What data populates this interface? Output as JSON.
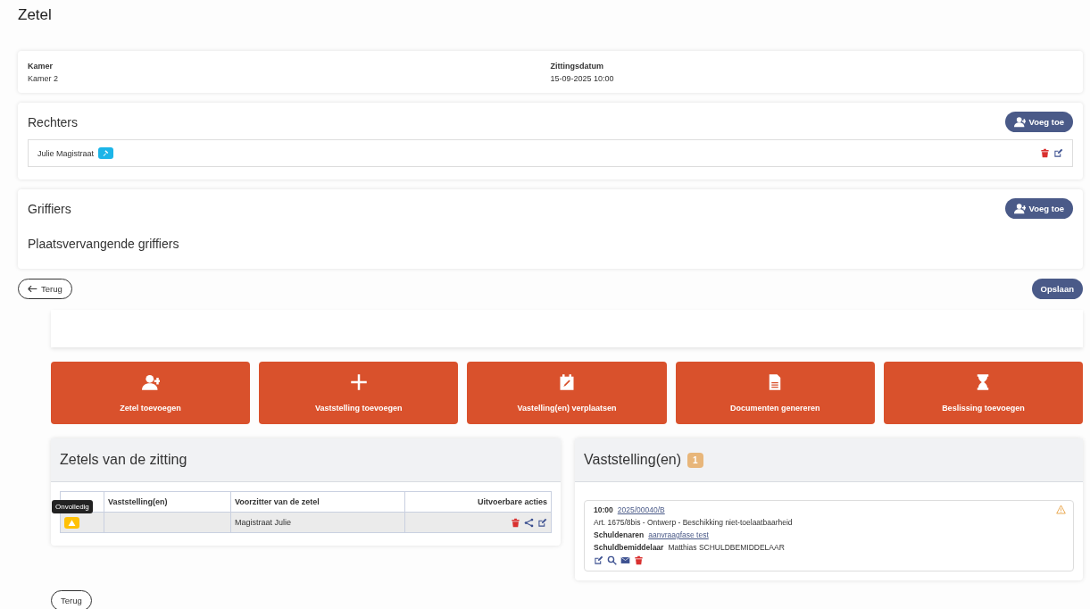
{
  "page": {
    "title": "Zetel"
  },
  "info": [
    {
      "label": "Kamer",
      "value": "Kamer 2"
    },
    {
      "label": "Zittingsdatum",
      "value": "15-09-2025 10:00"
    }
  ],
  "rechters": {
    "title": "Rechters",
    "add_button": "Voeg toe",
    "members": [
      {
        "name": "Julie Magistraat"
      }
    ]
  },
  "griffiers": {
    "title": "Griffiers",
    "add_button": "Voeg toe",
    "subtitle": "Plaatsvervangende griffiers"
  },
  "back_button": "Terug",
  "save_button": "Opslaan",
  "actions": [
    {
      "label": "Zetel toevoegen",
      "kind": "seat"
    },
    {
      "label": "Vaststelling toevoegen",
      "kind": "plus"
    },
    {
      "label": "Vastelling(en) verplaatsen",
      "kind": "calendar"
    },
    {
      "label": "Documenten genereren",
      "kind": "document"
    },
    {
      "label": "Beslissing toevoegen",
      "kind": "hourglass"
    }
  ],
  "seats_panel": {
    "title": "Zetels van de zitting",
    "columns": [
      "Vaststelling(en)",
      "Voorzitter van de zetel",
      "Uitvoerbare acties"
    ],
    "rows": [
      {
        "tooltip": "Onvolledig",
        "chairman": "Magistraat Julie"
      }
    ]
  },
  "findings_panel": {
    "title": "Vaststelling(en)",
    "count": "1",
    "items": [
      {
        "time": "10:00",
        "case": "2025/00040/B",
        "description": "Art. 1675/8bis - Ontwerp - Beschikking niet-toelaatbaarheid",
        "debtors_label": "Schuldenaren",
        "debtors": "aanvraagfase test",
        "mediator_label": "Schuldbemiddelaar",
        "mediator": "Matthias SCHULDBEMIDDELAAR",
        "warning": true
      }
    ]
  },
  "bottom_back_button": "Terug"
}
